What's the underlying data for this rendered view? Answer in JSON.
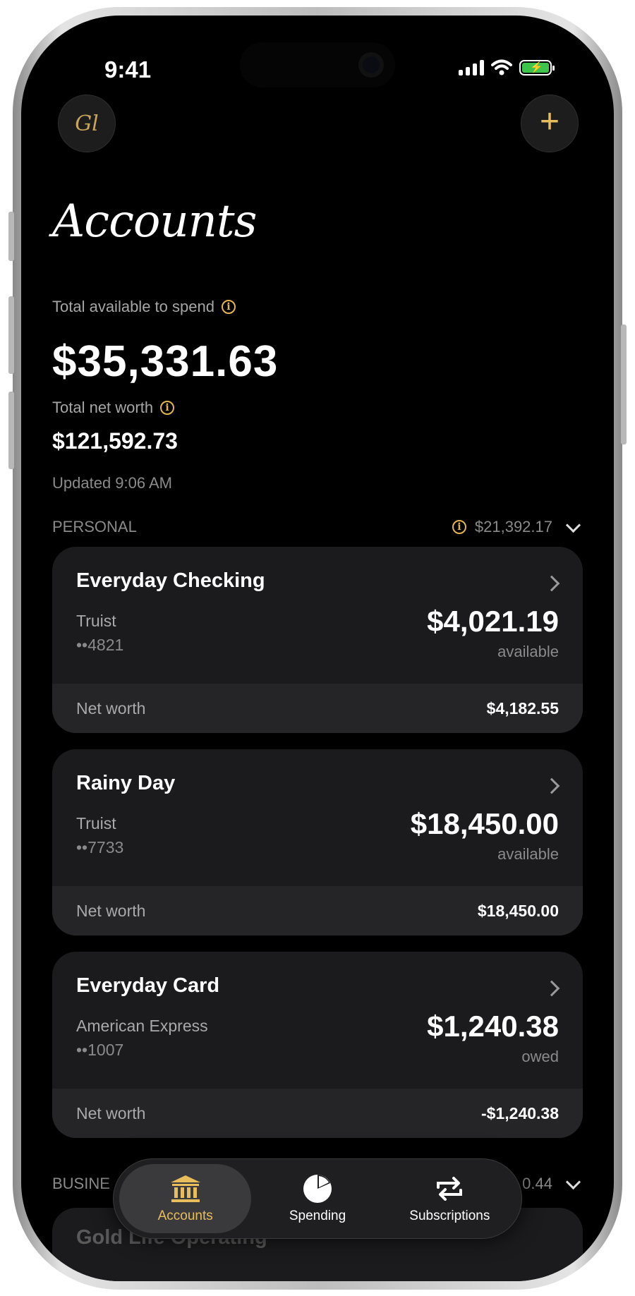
{
  "status_bar": {
    "time": "9:41"
  },
  "header": {
    "monogram": "Gl",
    "title": "Accounts"
  },
  "summary": {
    "available_label": "Total available to spend",
    "available_amount": "$35,331.63",
    "net_worth_label": "Total net worth",
    "net_worth_amount": "$121,592.73",
    "updated": "Updated 9:06 AM"
  },
  "personal": {
    "label": "PERSONAL",
    "total": "$21,392.17",
    "accounts": [
      {
        "name": "Everyday Checking",
        "institution": "Truist",
        "mask": "••4821",
        "amount": "$4,021.19",
        "status": "available",
        "net_worth_label": "Net worth",
        "net_worth": "$4,182.55"
      },
      {
        "name": "Rainy Day",
        "institution": "Truist",
        "mask": "••7733",
        "amount": "$18,450.00",
        "status": "available",
        "net_worth_label": "Net worth",
        "net_worth": "$18,450.00"
      },
      {
        "name": "Everyday Card",
        "institution": "American Express",
        "mask": "••1007",
        "amount": "$1,240.38",
        "status": "owed",
        "net_worth_label": "Net worth",
        "net_worth": "-$1,240.38"
      }
    ]
  },
  "business": {
    "label": "BUSINE",
    "total_partial": "0.44",
    "first_account": "Gold Life Operating"
  },
  "tabbar": {
    "tabs": [
      {
        "label": "Accounts",
        "icon": "bank-icon",
        "active": true
      },
      {
        "label": "Spending",
        "icon": "pie-chart-icon",
        "active": false
      },
      {
        "label": "Subscriptions",
        "icon": "repeat-icon",
        "active": false
      }
    ]
  },
  "colors": {
    "accent": "#e8bd5c",
    "card": "#1b1b1d",
    "card_footer": "#252527",
    "battery": "#3ec34c"
  }
}
